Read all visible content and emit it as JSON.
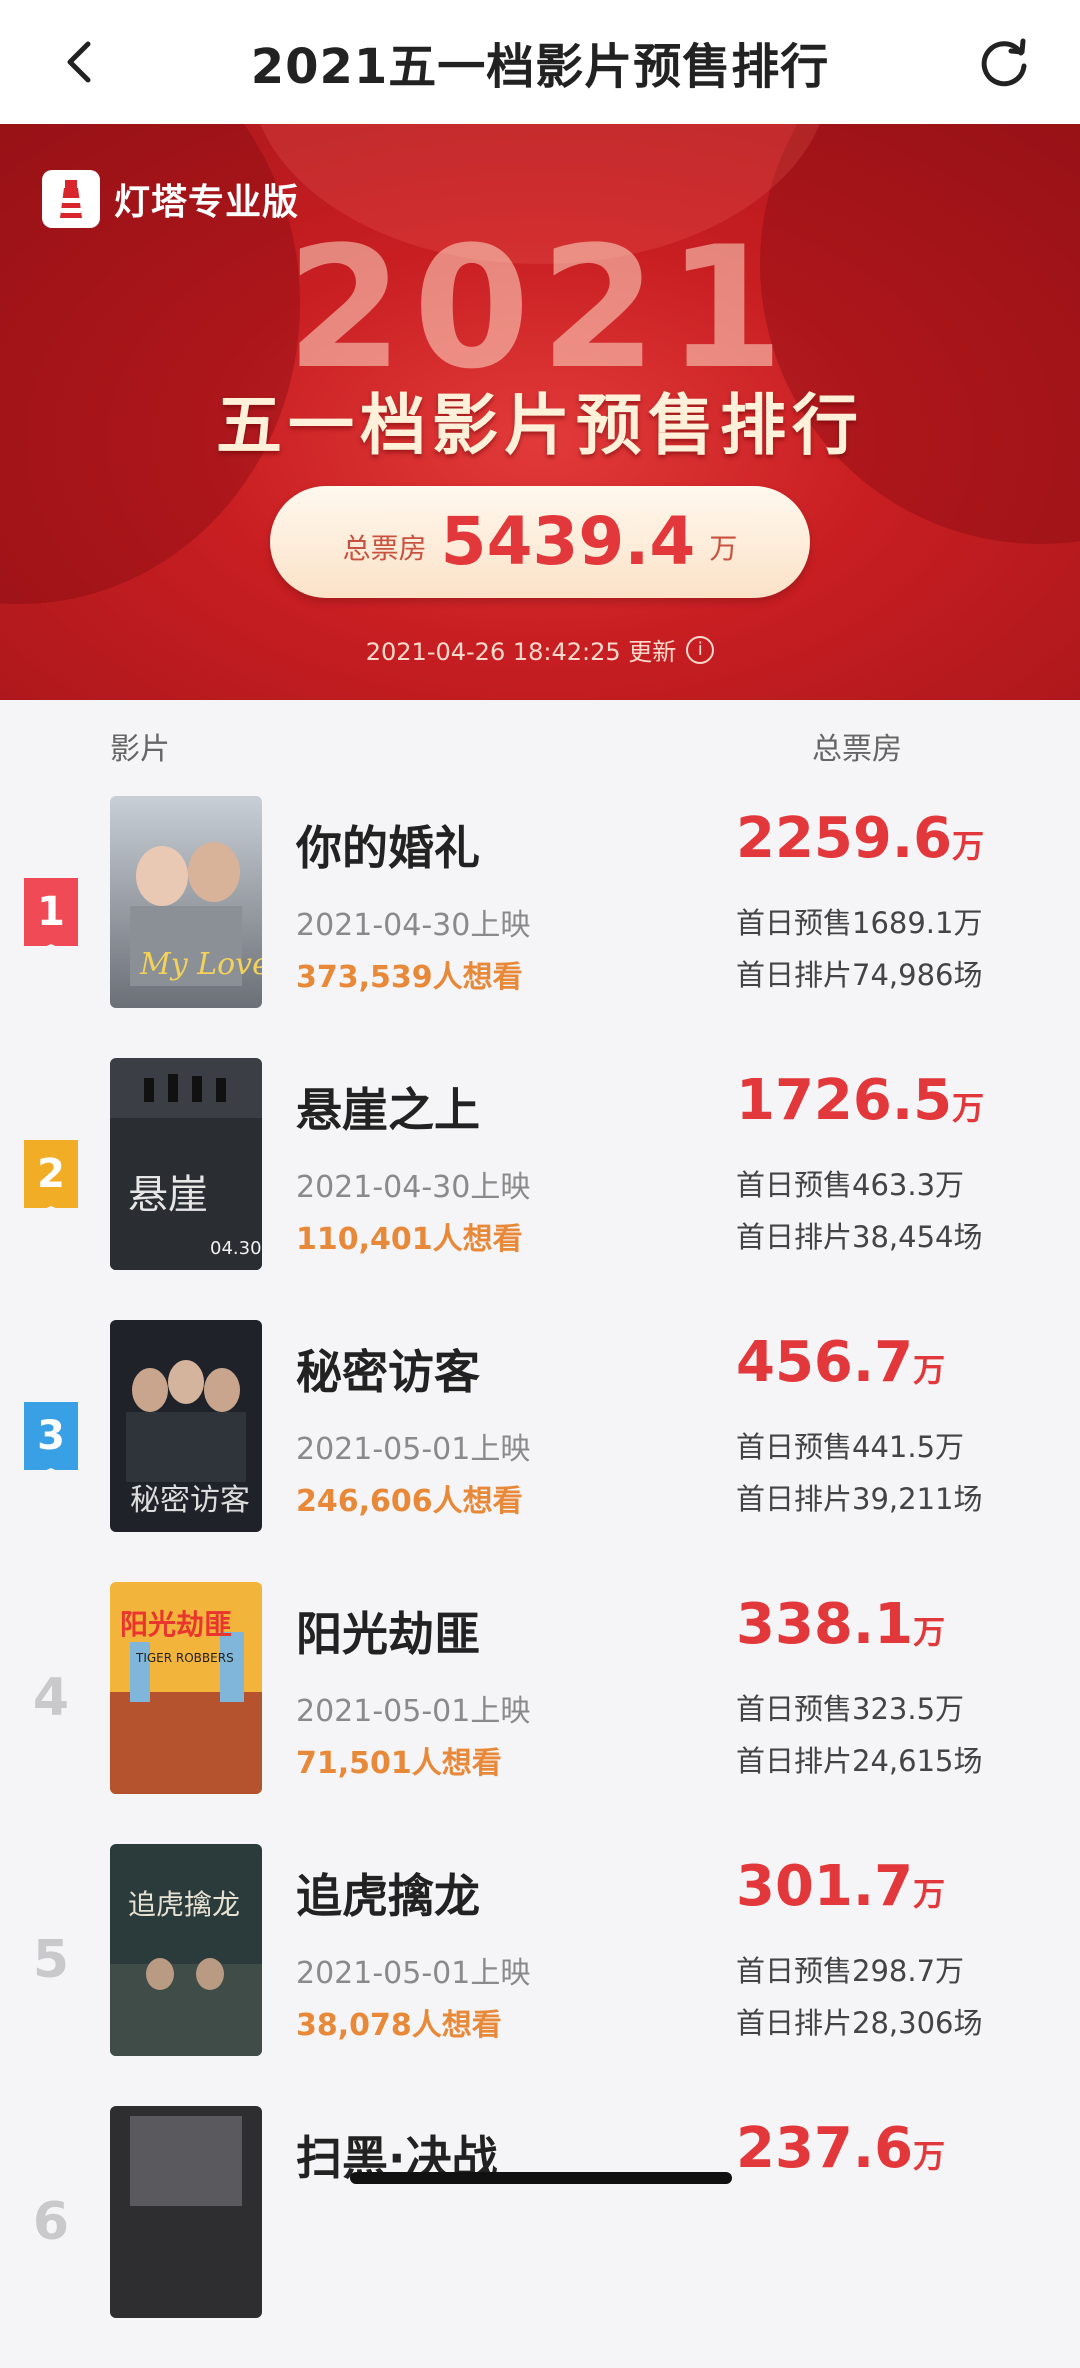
{
  "nav": {
    "title": "2021五一档影片预售排行",
    "back_icon": "chevron-left-icon",
    "refresh_icon": "refresh-icon"
  },
  "banner": {
    "brand": "灯塔专业版",
    "year": "2021",
    "headline": "五一档影片预售排行",
    "total_label": "总票房",
    "total_value": "5439.4",
    "total_unit": "万",
    "updated": "2021-04-26 18:42:25 更新",
    "colors": {
      "primary_red": "#c81e22",
      "accent_red": "#e2383b",
      "orange": "#e8893a"
    }
  },
  "list": {
    "col_film": "影片",
    "col_total": "总票房",
    "movies": [
      {
        "rank": "1",
        "name": "你的婚礼",
        "release": "2021-04-30上映",
        "want": "373,539人想看",
        "box": "2259.6",
        "unit": "万",
        "presale": "首日预售1689.1万",
        "screens": "首日排片74,986场",
        "rank_color": "#ef4a55"
      },
      {
        "rank": "2",
        "name": "悬崖之上",
        "release": "2021-04-30上映",
        "want": "110,401人想看",
        "box": "1726.5",
        "unit": "万",
        "presale": "首日预售463.3万",
        "screens": "首日排片38,454场",
        "rank_color": "#f2ad26"
      },
      {
        "rank": "3",
        "name": "秘密访客",
        "release": "2021-05-01上映",
        "want": "246,606人想看",
        "box": "456.7",
        "unit": "万",
        "presale": "首日预售441.5万",
        "screens": "首日排片39,211场",
        "rank_color": "#3aa0e6"
      },
      {
        "rank": "4",
        "name": "阳光劫匪",
        "release": "2021-05-01上映",
        "want": "71,501人想看",
        "box": "338.1",
        "unit": "万",
        "presale": "首日预售323.5万",
        "screens": "首日排片24,615场"
      },
      {
        "rank": "5",
        "name": "追虎擒龙",
        "release": "2021-05-01上映",
        "want": "38,078人想看",
        "box": "301.7",
        "unit": "万",
        "presale": "首日预售298.7万",
        "screens": "首日排片28,306场"
      },
      {
        "rank": "6",
        "name": "扫黑·决战",
        "box": "237.6",
        "unit": "万"
      }
    ]
  }
}
